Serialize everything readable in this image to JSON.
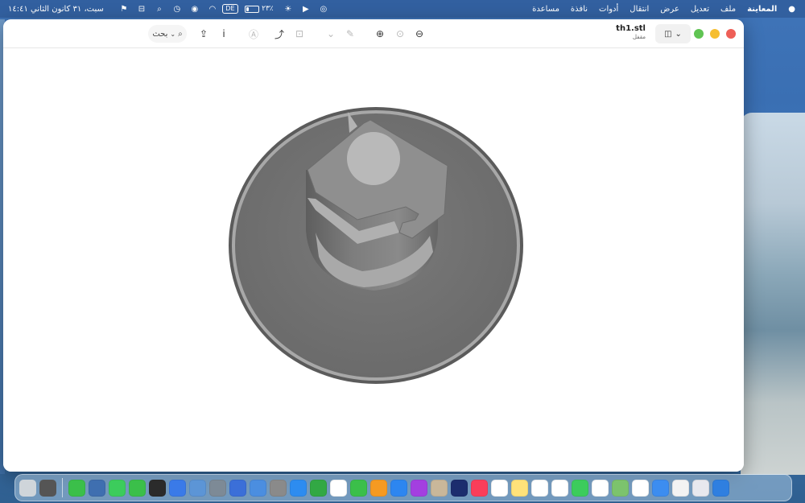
{
  "menubar": {
    "app_name": "المعاينة",
    "menus": [
      "ملف",
      "تعديل",
      "عرض",
      "انتقال",
      "أدوات",
      "نافذة",
      "مساعدة"
    ],
    "clock": "سبت، ٣١ كانون الثاني ١٤:٤١",
    "battery_text": "٢٣٪",
    "battery_level": 0.23,
    "input_source": "DE"
  },
  "window": {
    "doc_name": "th1.stl",
    "doc_status": "مقفل",
    "search_label": "بحث"
  },
  "dock": {
    "icons": [
      {
        "name": "finder",
        "color": "#2f7fe0"
      },
      {
        "name": "launchpad",
        "color": "#e8e8ee"
      },
      {
        "name": "notes-app",
        "color": "#f3f3f3"
      },
      {
        "name": "mail",
        "color": "#3c8df0"
      },
      {
        "name": "chrome",
        "color": "#ffffff"
      },
      {
        "name": "maps",
        "color": "#7cc36d"
      },
      {
        "name": "photos",
        "color": "#ffffff"
      },
      {
        "name": "facetime",
        "color": "#3ccc5c"
      },
      {
        "name": "calendar",
        "color": "#ffffff"
      },
      {
        "name": "reminders",
        "color": "#ffffff"
      },
      {
        "name": "notes",
        "color": "#ffe27a"
      },
      {
        "name": "freeform",
        "color": "#ffffff"
      },
      {
        "name": "music",
        "color": "#fa3d5a"
      },
      {
        "name": "hd-app",
        "color": "#1c2d6e"
      },
      {
        "name": "contacts",
        "color": "#c9b79a"
      },
      {
        "name": "podcasts",
        "color": "#a33fe0"
      },
      {
        "name": "keynote",
        "color": "#2d86f0"
      },
      {
        "name": "pages",
        "color": "#f59a22"
      },
      {
        "name": "numbers",
        "color": "#3bbf4a"
      },
      {
        "name": "drop-app",
        "color": "#ffffff"
      },
      {
        "name": "numbers-2",
        "color": "#32a844"
      },
      {
        "name": "app-store",
        "color": "#2d8cf0"
      },
      {
        "name": "system-settings",
        "color": "#8a8a8a"
      },
      {
        "name": "preview",
        "color": "#4b8ee0"
      },
      {
        "name": "screenshot",
        "color": "#3b6fd8"
      },
      {
        "name": "help",
        "color": "#7d8a96"
      },
      {
        "name": "preview-2",
        "color": "#5c95d6"
      },
      {
        "name": "xcode-sim",
        "color": "#3a7ae8"
      },
      {
        "name": "blender",
        "color": "#2b2b2b"
      },
      {
        "name": "numbers-3",
        "color": "#3bbf4a"
      },
      {
        "name": "phone",
        "color": "#3ccc5c"
      },
      {
        "name": "quicktime",
        "color": "#3f6fb0"
      },
      {
        "name": "numbers-4",
        "color": "#3bbf4a"
      }
    ],
    "right_icons": [
      {
        "name": "window-thumb",
        "color": "#555555"
      },
      {
        "name": "trash",
        "color": "#cfd5da"
      }
    ]
  }
}
